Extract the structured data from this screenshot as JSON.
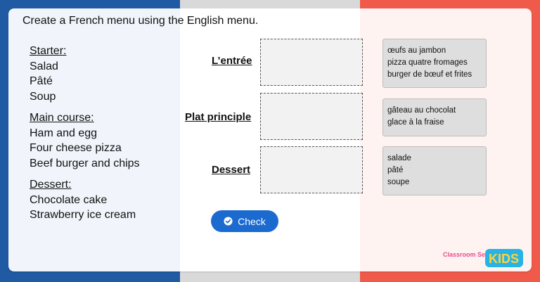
{
  "instruction": "Create a French menu using the English menu.",
  "english_menu": [
    {
      "heading": "Starter:",
      "items": [
        "Salad",
        "Pâté",
        "Soup"
      ]
    },
    {
      "heading": "Main course:",
      "items": [
        "Ham and egg",
        "Four cheese pizza",
        "Beef burger and chips"
      ]
    },
    {
      "heading": "Dessert:",
      "items": [
        "Chocolate cake",
        "Strawberry ice cream"
      ]
    }
  ],
  "french_labels": {
    "entree": "L’entrée",
    "plat": "Plat principle",
    "dessert": "Dessert"
  },
  "options": [
    {
      "lines": [
        "œufs au jambon",
        "pizza quatre fromages",
        "burger de bœuf et frites"
      ]
    },
    {
      "lines": [
        "gâteau au chocolat",
        "glace à la fraise"
      ]
    },
    {
      "lines": [
        "salade",
        "pâté",
        "soupe"
      ]
    }
  ],
  "check_button": {
    "label": "Check",
    "icon": "check-circle-icon"
  },
  "brand": {
    "name": "Classroom Secrets",
    "kids": "KIDS"
  },
  "colors": {
    "flag_blue": "#1f5aa3",
    "flag_red": "#f05a4b",
    "button": "#1b6ad0"
  }
}
